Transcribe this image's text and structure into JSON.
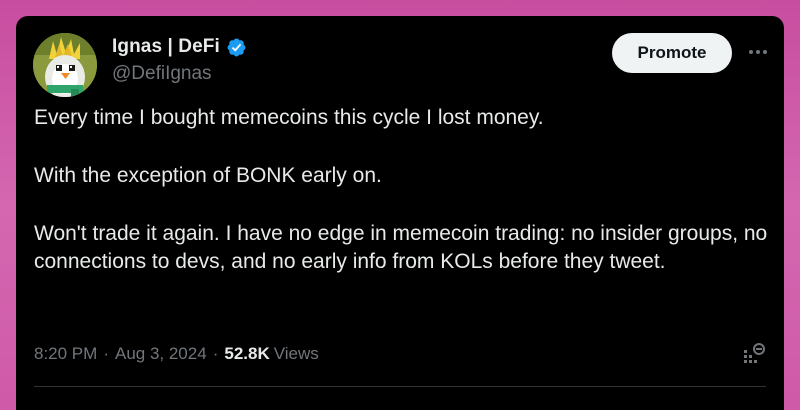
{
  "author": {
    "display_name": "Ignas | DeFi",
    "handle": "@DefiIgnas",
    "verified": true,
    "avatar": "pixel-penguin-avatar"
  },
  "header": {
    "promote_label": "Promote",
    "more_icon": "more-horizontal-icon"
  },
  "tweet": {
    "paragraphs": [
      "Every time I bought memecoins this cycle I lost money.",
      "With the exception of BONK early on.",
      "Won't trade it again. I have no edge in memecoin trading: no insider groups, no connections to devs, and no early info from KOLs before they tweet."
    ]
  },
  "meta": {
    "time": "8:20 PM",
    "separator": "·",
    "date": "Aug 3, 2024",
    "views_count": "52.8K",
    "views_label": "Views",
    "analytics_icon": "analytics-icon"
  },
  "colors": {
    "background": "#cf5aa8",
    "card": "#000000",
    "text": "#e7e9ea",
    "muted": "#71767b",
    "verified": "#1d9bf0",
    "button_bg": "#eff3f4"
  }
}
